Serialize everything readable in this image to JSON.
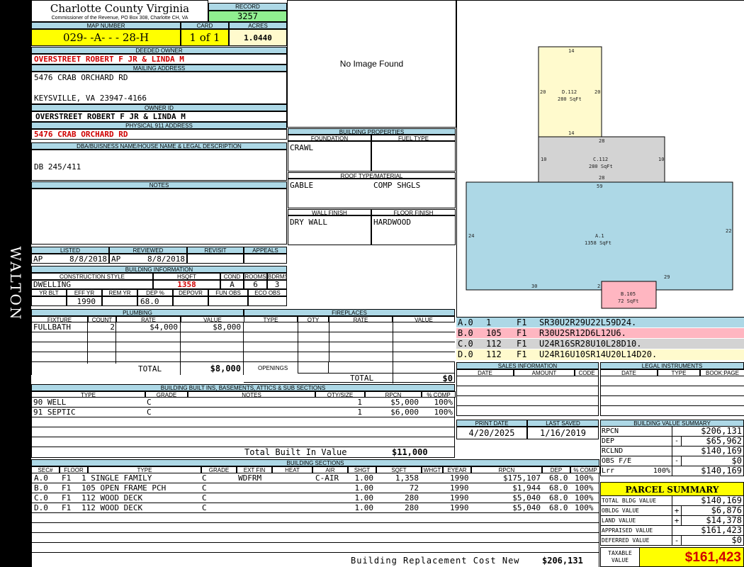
{
  "sidebar": {
    "district": "WALTON"
  },
  "header": {
    "county": "Charlotte County Virginia",
    "address": "Commissioner of the Revenue, PO Box 308, Charlotte CH, VA",
    "record_label": "RECORD",
    "record": "3257"
  },
  "map": {
    "map_label": "MAP NUMBER",
    "map_number": "029- -A- - - 28-H",
    "card_label": "CARD",
    "card": "1 of 1",
    "acres_label": "ACRES",
    "acres": "1.0440"
  },
  "owner": {
    "deeded_label": "DEEDED OWNER",
    "deeded": "OVERSTREET ROBERT F JR & LINDA M",
    "mailing_label": "MAILING ADDRESS",
    "mailing1": "5476 CRAB ORCHARD RD",
    "mailing2": "KEYSVILLE, VA 23947-4166",
    "id_label": "OWNER ID",
    "id": "OVERSTREET ROBERT F JR & LINDA M",
    "phys_label": "PHYSICAL 911 ADDRESS",
    "phys": "5476 CRAB ORCHARD RD"
  },
  "dba": {
    "label": "DBA/BUISNESS NAME/HOUSE NAME & LEGAL DESCRIPTION",
    "value": "DB 245/411"
  },
  "notes": {
    "label": "NOTES"
  },
  "image": {
    "message": "No Image Found"
  },
  "listing": {
    "listed_label": "LISTED",
    "reviewed_label": "REVIEWED",
    "revisit_label": "REVISIT",
    "appeals_label": "APPEALS",
    "listed_by": "AP",
    "listed": "8/8/2018",
    "reviewed_by": "AP",
    "reviewed": "8/8/2018"
  },
  "building_info": {
    "label": "BUILDING INFORMATION",
    "style_label": "CONSTRUCTION STYLE",
    "hsqft_label": "HSQFT",
    "cond_label": "COND",
    "rooms_label": "ROOMS",
    "bdrms_label": "BDRMS",
    "style": "DWELLING",
    "hsqft": "1358",
    "cond": "A",
    "rooms": "6",
    "bdrms": "3",
    "yrblt_label": "YR BLT",
    "effyr_label": "EFF YR",
    "remyr_label": "REM YR",
    "dep_label": "DEP %",
    "depovr_label": "DEPOVR",
    "funobs_label": "FUN OBS",
    "ecoobs_label": "ECO OBS",
    "effyr": "1990",
    "dep": "68.0"
  },
  "building_props": {
    "label": "BUILDING PROPERTIES",
    "foundation_label": "FOUNDATION",
    "fuel_label": "FUEL TYPE",
    "foundation": "CRAWL",
    "roof_label": "ROOF TYPE/MATERIAL",
    "roof_type": "GABLE",
    "roof_mat": "COMP SHGLS",
    "wall_label": "WALL FINISH",
    "floor_label": "FLOOR FINISH",
    "wall": "DRY WALL",
    "floor": "HARDWOOD"
  },
  "plumbing": {
    "label": "PLUMBING",
    "h_fixture": "FIXTURE",
    "h_count": "COUNT",
    "h_rate": "RATE",
    "h_value": "VALUE",
    "rows": [
      {
        "fixture": "FULLBATH",
        "count": "2",
        "rate": "$4,000",
        "value": "$8,000"
      }
    ],
    "total_label": "TOTAL",
    "total": "$8,000"
  },
  "fireplaces": {
    "label": "FIREPLACES",
    "h_type": "TYPE",
    "h_qty": "QTY",
    "h_rate": "RATE",
    "h_value": "VALUE",
    "openings_label": "OPENINGS",
    "total_label": "TOTAL",
    "total": "$0"
  },
  "builtins": {
    "label": "BUILDING BUILT INS, BASEMENTS, ATTICS & SUB SECTIONS",
    "h_type": "TYPE",
    "h_grade": "GRADE",
    "h_notes": "NOTES",
    "h_qty": "QTY/SIZE",
    "h_rpcn": "RPCN",
    "h_comp": "% COMP",
    "rows": [
      {
        "type": "90 WELL",
        "grade": "C",
        "qty": "1",
        "rpcn": "$5,000",
        "comp": "100%"
      },
      {
        "type": "91 SEPTIC",
        "grade": "C",
        "qty": "1",
        "rpcn": "$6,000",
        "comp": "100%"
      }
    ],
    "total_label": "Total Built In Value",
    "total": "$11,000"
  },
  "sections": {
    "label": "BUILDING SECTIONS",
    "h_sec": "SEC#",
    "h_floor": "FLOOR",
    "h_type": "TYPE",
    "h_grade": "GRADE",
    "h_extfin": "EXT FIN",
    "h_heat": "HEAT",
    "h_air": "AIR",
    "h_shgt": "SHGT",
    "h_sqft": "SQFT",
    "h_whgt": "WHGT",
    "h_eyear": "EYEAR",
    "h_rpcn": "RPCN",
    "h_dep": "DEP",
    "h_comp": "% COMP",
    "rows": [
      {
        "sec": "A.0",
        "floor": "F1",
        "type": "1 SINGLE FAMILY",
        "grade": "C",
        "extfin": "WDFRM",
        "heat": "",
        "air": "C-AIR",
        "shgt": "1.00",
        "sqft": "1,358",
        "eyear": "1990",
        "rpcn": "$175,107",
        "dep": "68.0",
        "comp": "100%"
      },
      {
        "sec": "B.0",
        "floor": "F1",
        "type": "105 OPEN FRAME PCH",
        "grade": "C",
        "extfin": "",
        "heat": "",
        "air": "",
        "shgt": "1.00",
        "sqft": "72",
        "eyear": "1990",
        "rpcn": "$1,944",
        "dep": "68.0",
        "comp": "100%"
      },
      {
        "sec": "C.0",
        "floor": "F1",
        "type": "112 WOOD DECK",
        "grade": "C",
        "extfin": "",
        "heat": "",
        "air": "",
        "shgt": "1.00",
        "sqft": "280",
        "eyear": "1990",
        "rpcn": "$5,040",
        "dep": "68.0",
        "comp": "100%"
      },
      {
        "sec": "D.0",
        "floor": "F1",
        "type": "112 WOOD DECK",
        "grade": "C",
        "extfin": "",
        "heat": "",
        "air": "",
        "shgt": "1.00",
        "sqft": "280",
        "eyear": "1990",
        "rpcn": "$5,040",
        "dep": "68.0",
        "comp": "100%"
      }
    ],
    "total_label": "Building Replacement Cost New",
    "total": "$206,131"
  },
  "sketch": {
    "d": {
      "label": "D.112",
      "area": "280 SqFt",
      "top": "14",
      "bottom": "14",
      "left": "20",
      "right": "20"
    },
    "c": {
      "label": "C.112",
      "area": "280 SqFt",
      "top": "28",
      "bottom": "28",
      "left": "10",
      "right": "10"
    },
    "a": {
      "label": "A.1",
      "area": "1358 SqFt",
      "top": "59",
      "left": "24",
      "right": "22",
      "b1": "30",
      "b2": "2",
      "b3": "29"
    },
    "b": {
      "label": "B.105",
      "area": "72 SqFt"
    }
  },
  "legend": [
    {
      "sec": "A.0",
      "code": "1",
      "floor": "F1",
      "path": "SR30U2R29U22L59D24.",
      "color": "#add8e6"
    },
    {
      "sec": "B.0",
      "code": "105",
      "floor": "F1",
      "path": "R30U2SR12D6L12U6.",
      "color": "#ffb6c1"
    },
    {
      "sec": "C.0",
      "code": "112",
      "floor": "F1",
      "path": "U24R16SR28U10L28D10.",
      "color": "#d3d3d3"
    },
    {
      "sec": "D.0",
      "code": "112",
      "floor": "F1",
      "path": "U24R16U10SR14U20L14D20.",
      "color": "#fffacd"
    }
  ],
  "sales": {
    "label": "SALES INFORMATION",
    "h_date": "DATE",
    "h_amount": "AMOUNT",
    "h_code": "CODE"
  },
  "legal": {
    "label": "LEGAL INSTRUMENTS",
    "h_date": "DATE",
    "h_type": "TYPE",
    "h_book": "BOOK:PAGE"
  },
  "print": {
    "print_label": "PRINT DATE",
    "saved_label": "LAST SAVED",
    "print_date": "4/20/2025",
    "last_saved": "1/16/2019"
  },
  "value_summary": {
    "label": "BUILDING VALUE SUMMARY",
    "rpcn_label": "RPCN",
    "rpcn": "$206,131",
    "dep_label": "DEP",
    "dep_sign": "-",
    "dep": "$65,962",
    "rclnd_label": "RCLND",
    "rclnd": "$140,169",
    "obs_label": "OBS F/E",
    "obs_sign": "-",
    "obs": "$0",
    "lrr_label": "Lrr",
    "lrr_pct": "100%",
    "lrr": "$140,169"
  },
  "parcel": {
    "label": "PARCEL SUMMARY",
    "bldg_label": "TOTAL BLDG VALUE",
    "bldg": "$140,169",
    "obldg_label": "OBLDG VALUE",
    "obldg_sign": "+",
    "obldg": "$6,876",
    "land_label": "LAND VALUE",
    "land_sign": "+",
    "land": "$14,378",
    "appraised_label": "APPRAISED VALUE",
    "appraised": "$161,423",
    "deferred_label": "DEFERRED VALUE",
    "deferred_sign": "-",
    "deferred": "$0",
    "taxable_label1": "TAXABLE",
    "taxable_label2": "VALUE",
    "taxable": "$161,423"
  }
}
